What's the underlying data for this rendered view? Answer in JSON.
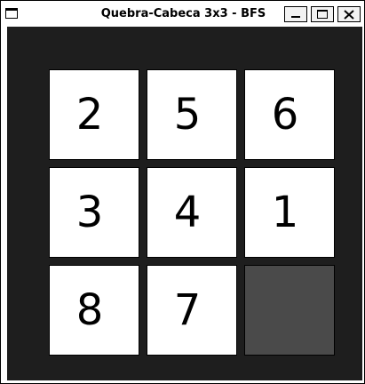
{
  "window": {
    "title": "Quebra-Cabeca 3x3 - BFS",
    "buttons": {
      "minimize_icon": "minimize-icon",
      "maximize_icon": "maximize-icon",
      "close_icon": "close-icon"
    }
  },
  "board": {
    "rows": 3,
    "cols": 3,
    "tiles": [
      "2",
      "5",
      "6",
      "3",
      "4",
      "1",
      "8",
      "7",
      ""
    ],
    "colors": {
      "background": "#1e1e1e",
      "tile": "#ffffff",
      "empty_tile": "#4a4a4a"
    }
  }
}
